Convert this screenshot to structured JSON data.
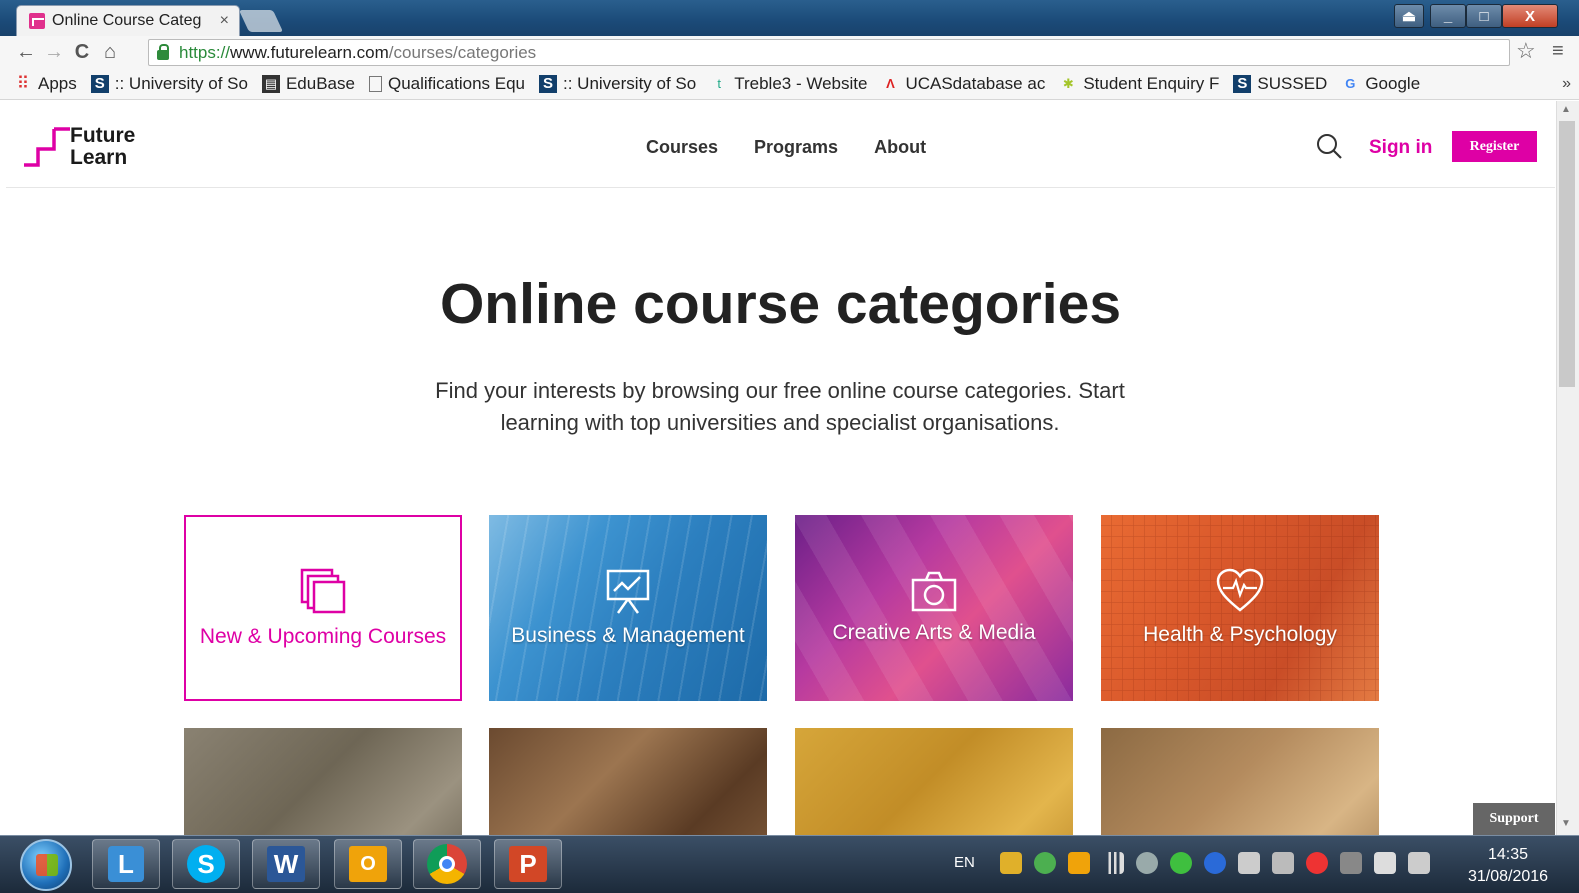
{
  "browser": {
    "tab_title": "Online Course Categ",
    "tab_close": "×",
    "url_scheme": "https://",
    "url_host": "www.futurelearn.com",
    "url_path": "/courses/categories",
    "nav": {
      "back": "←",
      "forward": "→",
      "reload": "C",
      "home": "⌂"
    },
    "star": "☆",
    "menu": "≡",
    "window_controls": {
      "minimize": "_",
      "maximize": "□",
      "close": "X"
    }
  },
  "bookmarks": [
    {
      "label": "Apps",
      "icon": "apps-grid-icon",
      "glyph": "⠿"
    },
    {
      "label": ":: University of So",
      "icon": "s-logo-icon",
      "glyph": "S"
    },
    {
      "label": "EduBase",
      "icon": "edubase-icon",
      "glyph": "▤"
    },
    {
      "label": "Qualifications Equ",
      "icon": "document-icon",
      "glyph": ""
    },
    {
      "label": ":: University of So",
      "icon": "s-logo-icon",
      "glyph": "S"
    },
    {
      "label": "Treble3 - Website",
      "icon": "treble3-icon",
      "glyph": "t"
    },
    {
      "label": "UCASdatabase ac",
      "icon": "ucas-icon",
      "glyph": "Λ"
    },
    {
      "label": "Student Enquiry F",
      "icon": "student-enquiry-icon",
      "glyph": "✱"
    },
    {
      "label": "SUSSED",
      "icon": "s-logo-icon",
      "glyph": "S"
    },
    {
      "label": "Google",
      "icon": "google-icon",
      "glyph": "G"
    }
  ],
  "bookmarks_more": "»",
  "site": {
    "logo_line1": "Future",
    "logo_line2": "Learn",
    "nav": [
      "Courses",
      "Programs",
      "About"
    ],
    "sign_in": "Sign in",
    "register": "Register",
    "brand_color": "#de00a5"
  },
  "main": {
    "title": "Online course categories",
    "intro": "Find your interests by browsing our free online course categories. Start learning with top universities and specialist organisations."
  },
  "categories": [
    {
      "label": "New & Upcoming Courses",
      "icon": "layers-icon"
    },
    {
      "label": "Business & Management",
      "icon": "presentation-chart-icon"
    },
    {
      "label": "Creative Arts & Media",
      "icon": "camera-icon"
    },
    {
      "label": "Health & Psychology",
      "icon": "heart-pulse-icon"
    },
    {
      "label": "",
      "icon": "castle-icon"
    },
    {
      "label": "",
      "icon": "speech-head-icon"
    },
    {
      "label": "",
      "icon": "scales-icon"
    },
    {
      "label": "",
      "icon": "open-book-icon"
    }
  ],
  "support": "Support",
  "taskbar": {
    "language": "EN",
    "time": "14:35",
    "date": "31/08/2016",
    "apps": [
      {
        "name": "lync",
        "glyph": "L"
      },
      {
        "name": "skype",
        "glyph": "S"
      },
      {
        "name": "word",
        "glyph": "W"
      },
      {
        "name": "outlook",
        "glyph": "O"
      },
      {
        "name": "chrome",
        "glyph": ""
      },
      {
        "name": "powerpoint",
        "glyph": "P"
      }
    ]
  }
}
